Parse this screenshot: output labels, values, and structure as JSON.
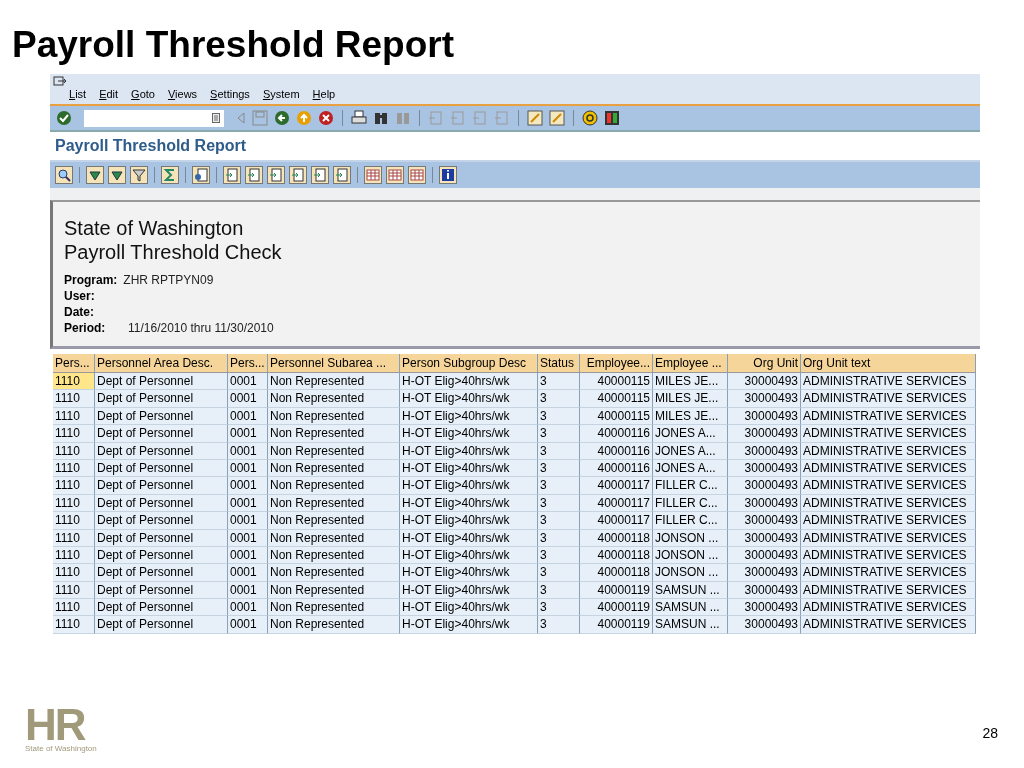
{
  "slide_title": "Payroll Threshold Report",
  "menu": [
    "List",
    "Edit",
    "Goto",
    "Views",
    "Settings",
    "System",
    "Help"
  ],
  "screen_title": "Payroll Threshold Report",
  "header": {
    "lines": [
      "State of Washington",
      "Payroll Threshold Check"
    ],
    "fields": [
      {
        "label": "Program:",
        "value": "ZHR  RPTPYN09"
      },
      {
        "label": "User:"
      },
      {
        "label": "Date:"
      },
      {
        "label": "Period:",
        "value": "11/16/2010 thru 11/30/2010"
      }
    ]
  },
  "table": {
    "columns": [
      {
        "label": "Pers...",
        "kind": "text"
      },
      {
        "label": "Personnel Area Desc.",
        "kind": "text"
      },
      {
        "label": "Pers...",
        "kind": "text"
      },
      {
        "label": "Personnel Subarea ...",
        "kind": "text"
      },
      {
        "label": "Person Subgroup Desc",
        "kind": "text"
      },
      {
        "label": "Status",
        "kind": "text"
      },
      {
        "label": "Employee...",
        "kind": "number"
      },
      {
        "label": "Employee ...",
        "kind": "text"
      },
      {
        "label": "Org Unit",
        "kind": "number"
      },
      {
        "label": "Org Unit text",
        "kind": "text"
      }
    ],
    "rows": [
      {
        "selected": true,
        "cells": [
          "1110",
          "Dept of Personnel",
          "0001",
          "Non Represented",
          "H-OT Elig>40hrs/wk",
          "3",
          "40000115",
          "MILES JE...",
          "30000493",
          "ADMINISTRATIVE SERVICES"
        ]
      },
      {
        "selected": false,
        "cells": [
          "1110",
          "Dept of Personnel",
          "0001",
          "Non Represented",
          "H-OT Elig>40hrs/wk",
          "3",
          "40000115",
          "MILES JE...",
          "30000493",
          "ADMINISTRATIVE SERVICES"
        ]
      },
      {
        "selected": false,
        "cells": [
          "1110",
          "Dept of Personnel",
          "0001",
          "Non Represented",
          "H-OT Elig>40hrs/wk",
          "3",
          "40000115",
          "MILES JE...",
          "30000493",
          "ADMINISTRATIVE SERVICES"
        ]
      },
      {
        "selected": false,
        "cells": [
          "1110",
          "Dept of Personnel",
          "0001",
          "Non Represented",
          "H-OT Elig>40hrs/wk",
          "3",
          "40000116",
          "JONES A...",
          "30000493",
          "ADMINISTRATIVE SERVICES"
        ]
      },
      {
        "selected": false,
        "cells": [
          "1110",
          "Dept of Personnel",
          "0001",
          "Non Represented",
          "H-OT Elig>40hrs/wk",
          "3",
          "40000116",
          "JONES A...",
          "30000493",
          "ADMINISTRATIVE SERVICES"
        ]
      },
      {
        "selected": false,
        "cells": [
          "1110",
          "Dept of Personnel",
          "0001",
          "Non Represented",
          "H-OT Elig>40hrs/wk",
          "3",
          "40000116",
          "JONES A...",
          "30000493",
          "ADMINISTRATIVE SERVICES"
        ]
      },
      {
        "selected": false,
        "cells": [
          "1110",
          "Dept of Personnel",
          "0001",
          "Non Represented",
          "H-OT Elig>40hrs/wk",
          "3",
          "40000117",
          "FILLER C...",
          "30000493",
          "ADMINISTRATIVE SERVICES"
        ]
      },
      {
        "selected": false,
        "cells": [
          "1110",
          "Dept of Personnel",
          "0001",
          "Non Represented",
          "H-OT Elig>40hrs/wk",
          "3",
          "40000117",
          "FILLER C...",
          "30000493",
          "ADMINISTRATIVE SERVICES"
        ]
      },
      {
        "selected": false,
        "cells": [
          "1110",
          "Dept of Personnel",
          "0001",
          "Non Represented",
          "H-OT Elig>40hrs/wk",
          "3",
          "40000117",
          "FILLER C...",
          "30000493",
          "ADMINISTRATIVE SERVICES"
        ]
      },
      {
        "selected": false,
        "cells": [
          "1110",
          "Dept of Personnel",
          "0001",
          "Non Represented",
          "H-OT Elig>40hrs/wk",
          "3",
          "40000118",
          "JONSON ...",
          "30000493",
          "ADMINISTRATIVE SERVICES"
        ]
      },
      {
        "selected": false,
        "cells": [
          "1110",
          "Dept of Personnel",
          "0001",
          "Non Represented",
          "H-OT Elig>40hrs/wk",
          "3",
          "40000118",
          "JONSON ...",
          "30000493",
          "ADMINISTRATIVE SERVICES"
        ]
      },
      {
        "selected": false,
        "cells": [
          "1110",
          "Dept of Personnel",
          "0001",
          "Non Represented",
          "H-OT Elig>40hrs/wk",
          "3",
          "40000118",
          "JONSON ...",
          "30000493",
          "ADMINISTRATIVE SERVICES"
        ]
      },
      {
        "selected": false,
        "cells": [
          "1110",
          "Dept of Personnel",
          "0001",
          "Non Represented",
          "H-OT Elig>40hrs/wk",
          "3",
          "40000119",
          "SAMSUN ...",
          "30000493",
          "ADMINISTRATIVE SERVICES"
        ]
      },
      {
        "selected": false,
        "cells": [
          "1110",
          "Dept of Personnel",
          "0001",
          "Non Represented",
          "H-OT Elig>40hrs/wk",
          "3",
          "40000119",
          "SAMSUN ...",
          "30000493",
          "ADMINISTRATIVE SERVICES"
        ]
      },
      {
        "selected": false,
        "cells": [
          "1110",
          "Dept of Personnel",
          "0001",
          "Non Represented",
          "H-OT Elig>40hrs/wk",
          "3",
          "40000119",
          "SAMSUN ...",
          "30000493",
          "ADMINISTRATIVE SERVICES"
        ]
      }
    ]
  },
  "logo": {
    "mark": "HR",
    "caption": "State of Washington"
  },
  "page_number": "28"
}
